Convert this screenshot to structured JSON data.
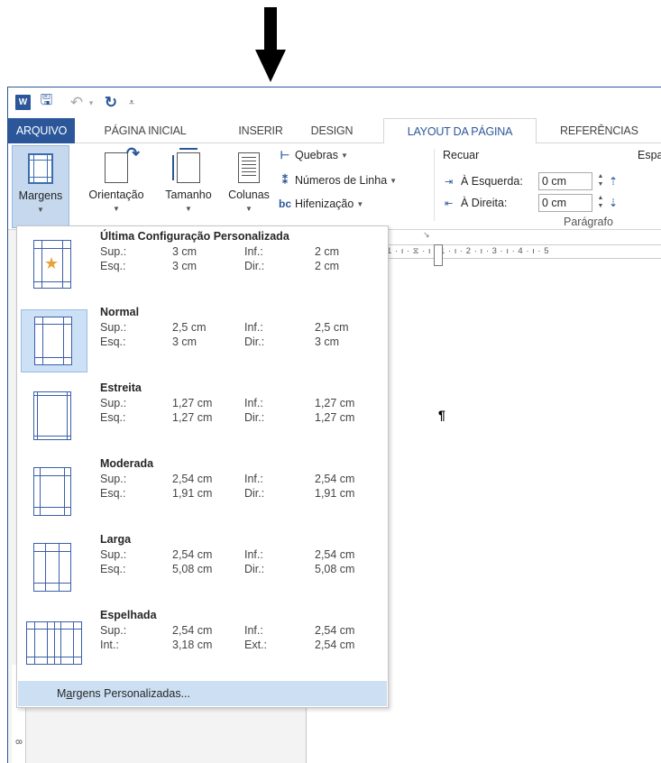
{
  "quick_access": {
    "word_icon": "word-icon",
    "save_icon": "save-icon",
    "undo_icon": "undo-icon",
    "redo_icon": "redo-icon"
  },
  "tabs": [
    {
      "label": "ARQUIVO"
    },
    {
      "label": "PÁGINA INICIAL"
    },
    {
      "label": "INSERIR"
    },
    {
      "label": "DESIGN"
    },
    {
      "label": "LAYOUT DA PÁGINA"
    },
    {
      "label": "REFERÊNCIAS"
    }
  ],
  "ribbon": {
    "margins_label": "Margens",
    "orientation_label": "Orientação",
    "size_label": "Tamanho",
    "columns_label": "Colunas",
    "breaks_label": "Quebras",
    "line_numbers_label": "Números de Linha",
    "hyphenation_label": "Hifenização",
    "indent_heading": "Recuar",
    "spacing_heading": "Espa",
    "indent_left_label": "À Esquerda:",
    "indent_left_value": "0 cm",
    "indent_right_label": "À Direita:",
    "indent_right_value": "0 cm",
    "paragraph_group": "Parágrafo"
  },
  "ruler_text": "1 · ı · ⧖ · ı · 1 · ı · 2 · ı · 3 · ı · 4 · ı · 5",
  "vertical_ruler_text": "8",
  "document": {
    "pilcrow": "¶"
  },
  "margins_menu": {
    "presets": [
      {
        "name": "Última Configuração Personalizada",
        "l1": "Sup.:",
        "v1": "3 cm",
        "l2": "Inf.:",
        "v2": "2 cm",
        "l3": "Esq.:",
        "v3": "3 cm",
        "l4": "Dir.:",
        "v4": "2 cm"
      },
      {
        "name": "Normal",
        "l1": "Sup.:",
        "v1": "2,5 cm",
        "l2": "Inf.:",
        "v2": "2,5 cm",
        "l3": "Esq.:",
        "v3": "3 cm",
        "l4": "Dir.:",
        "v4": "3 cm"
      },
      {
        "name": "Estreita",
        "l1": "Sup.:",
        "v1": "1,27 cm",
        "l2": "Inf.:",
        "v2": "1,27 cm",
        "l3": "Esq.:",
        "v3": "1,27 cm",
        "l4": "Dir.:",
        "v4": "1,27 cm"
      },
      {
        "name": "Moderada",
        "l1": "Sup.:",
        "v1": "2,54 cm",
        "l2": "Inf.:",
        "v2": "2,54 cm",
        "l3": "Esq.:",
        "v3": "1,91 cm",
        "l4": "Dir.:",
        "v4": "1,91 cm"
      },
      {
        "name": "Larga",
        "l1": "Sup.:",
        "v1": "2,54 cm",
        "l2": "Inf.:",
        "v2": "2,54 cm",
        "l3": "Esq.:",
        "v3": "5,08 cm",
        "l4": "Dir.:",
        "v4": "5,08 cm"
      },
      {
        "name": "Espelhada",
        "l1": "Sup.:",
        "v1": "2,54 cm",
        "l2": "Inf.:",
        "v2": "2,54 cm",
        "l3": "Int.:",
        "v3": "3,18 cm",
        "l4": "Ext.:",
        "v4": "2,54 cm"
      }
    ],
    "custom_pre": "M",
    "custom_underlined": "a",
    "custom_post": "rgens Personalizadas..."
  },
  "colors": {
    "accent": "#2b579a",
    "selected_bg": "#cce0f6",
    "hover_bg": "#cde0f3"
  }
}
